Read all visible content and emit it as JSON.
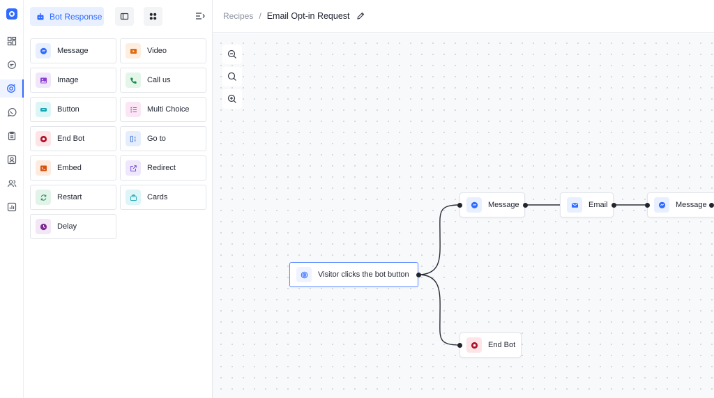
{
  "panel": {
    "active_tab_label": "Bot Response",
    "blocks": [
      {
        "label": "Message",
        "icon": "message-icon",
        "color": "#2f6bff",
        "bg": "#e8efff"
      },
      {
        "label": "Video",
        "icon": "video-icon",
        "color": "#e06a12",
        "bg": "#fdeee0"
      },
      {
        "label": "Image",
        "icon": "image-icon",
        "color": "#8a3fd1",
        "bg": "#f1e7fb"
      },
      {
        "label": "Call us",
        "icon": "phone-icon",
        "color": "#1c8a4a",
        "bg": "#e4f5ea"
      },
      {
        "label": "Button",
        "icon": "button-icon",
        "color": "#1aa6b0",
        "bg": "#dcf5f6"
      },
      {
        "label": "Multi Choice",
        "icon": "list-icon",
        "color": "#c23fa7",
        "bg": "#fbe6f6"
      },
      {
        "label": "End Bot",
        "icon": "stop-icon",
        "color": "#b3122a",
        "bg": "#fde4e7"
      },
      {
        "label": "Go to",
        "icon": "goto-icon",
        "color": "#3a6fd8",
        "bg": "#e6eefc"
      },
      {
        "label": "Embed",
        "icon": "embed-icon",
        "color": "#d4530f",
        "bg": "#fdebdf"
      },
      {
        "label": "Redirect",
        "icon": "redirect-icon",
        "color": "#6b3ed6",
        "bg": "#efe8fc"
      },
      {
        "label": "Restart",
        "icon": "restart-icon",
        "color": "#1f8f5a",
        "bg": "#e2f4ea"
      },
      {
        "label": "Cards",
        "icon": "cards-icon",
        "color": "#22a9b6",
        "bg": "#ddf5f7"
      },
      {
        "label": "Delay",
        "icon": "clock-icon",
        "color": "#7a2b8f",
        "bg": "#f3e6f7"
      }
    ]
  },
  "header": {
    "breadcrumb": "Recipes",
    "separator": "/",
    "title": "Email Opt-in Request"
  },
  "flow": {
    "trigger": "Visitor clicks the bot button",
    "nodes": [
      {
        "label": "Message",
        "icon": "message-icon"
      },
      {
        "label": "Email",
        "icon": "email-icon"
      },
      {
        "label": "Message",
        "icon": "message-icon"
      },
      {
        "label": "End Bot",
        "icon": "stop-icon"
      }
    ]
  }
}
